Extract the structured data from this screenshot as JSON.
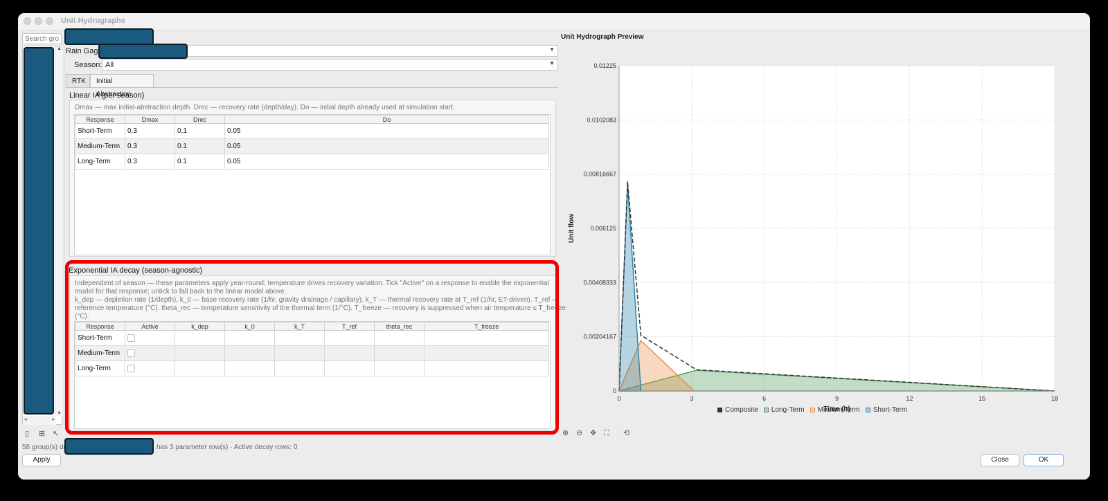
{
  "window": {
    "title": "Unit Hydrographs"
  },
  "left_panel": {
    "search_placeholder": "Search gro...",
    "status_prefix": "58 group(s) de",
    "status_suffix": "has 3 parameter row(s)  ·  Active decay rows: 0",
    "apply_label": "Apply"
  },
  "editor": {
    "rain_gage_label": "Rain Gage:",
    "season_label": "Season:",
    "season_value": "All",
    "tabs": [
      "RTK",
      "Initial Abstraction"
    ],
    "linear": {
      "title": "Linear IA (per season)",
      "description": "Dmax — max initial-abstraction depth. Drec — recovery rate (depth/day). Do — initial depth already used at simulation start.",
      "columns": [
        "Response",
        "Dmax",
        "Drec",
        "Do"
      ],
      "rows": [
        [
          "Short-Term",
          "0.3",
          "0.1",
          "0.05"
        ],
        [
          "Medium-Term",
          "0.3",
          "0.1",
          "0.05"
        ],
        [
          "Long-Term",
          "0.3",
          "0.1",
          "0.05"
        ]
      ]
    },
    "exponential": {
      "title": "Exponential IA decay (season-agnostic)",
      "desc_line1": "Independent of season — these parameters apply year-round; temperature drives recovery variation. Tick \"Active\" on a response to enable the exponential",
      "desc_line2": "model for that response; untick to fall back to the linear model above.",
      "desc_line3": "k_dep — depletion rate (1/depth). k_0 — base recovery rate (1/hr, gravity drainage / capillary). k_T — thermal recovery rate at T_ref (1/hr, ET-driven). T_ref —",
      "desc_line4": "reference temperature (°C). theta_rec — temperature sensitivity of the thermal term (1/°C). T_freeze — recovery is suppressed when air temperature ≤ T_freeze",
      "desc_line5": "(°C).",
      "columns": [
        "Response",
        "Active",
        "k_dep",
        "k_0",
        "k_T",
        "T_ref",
        "theta_rec",
        "T_freeze"
      ],
      "rows": [
        "Short-Term",
        "Medium-Term",
        "Long-Term"
      ]
    }
  },
  "preview": {
    "title": "Unit Hydrograph Preview",
    "close_label": "Close",
    "ok_label": "OK"
  },
  "chart_data": {
    "type": "area",
    "title": "",
    "xlabel": "Time (h)",
    "ylabel": "Unit flow",
    "xlim": [
      0,
      18
    ],
    "ylim": [
      0,
      0.01225
    ],
    "x_ticks": [
      0,
      3,
      6,
      9,
      12,
      15,
      18
    ],
    "y_ticks": [
      "0",
      "0.00204167",
      "0.00408333",
      "0.006125",
      "0.00816667",
      "0.0102083",
      "0.01225"
    ],
    "grid": true,
    "legend_position": "bottom",
    "series": [
      {
        "name": "Composite",
        "color": "#333333",
        "style": "dashed line",
        "points": [
          [
            0,
            0
          ],
          [
            0.35,
            0.0079
          ],
          [
            0.9,
            0.0021
          ],
          [
            3.2,
            0.0008
          ],
          [
            18,
            0
          ]
        ]
      },
      {
        "name": "Long-Term",
        "color": "#4f9a58",
        "points": [
          [
            0,
            0
          ],
          [
            3.2,
            0.00078
          ],
          [
            18,
            0
          ]
        ]
      },
      {
        "name": "Medium-Term",
        "color": "#e8924a",
        "points": [
          [
            0,
            0
          ],
          [
            0.9,
            0.0019
          ],
          [
            3.1,
            0
          ]
        ]
      },
      {
        "name": "Short-Term",
        "color": "#2e86ab",
        "points": [
          [
            0,
            0
          ],
          [
            0.35,
            0.0078
          ],
          [
            0.9,
            0
          ]
        ]
      }
    ]
  }
}
